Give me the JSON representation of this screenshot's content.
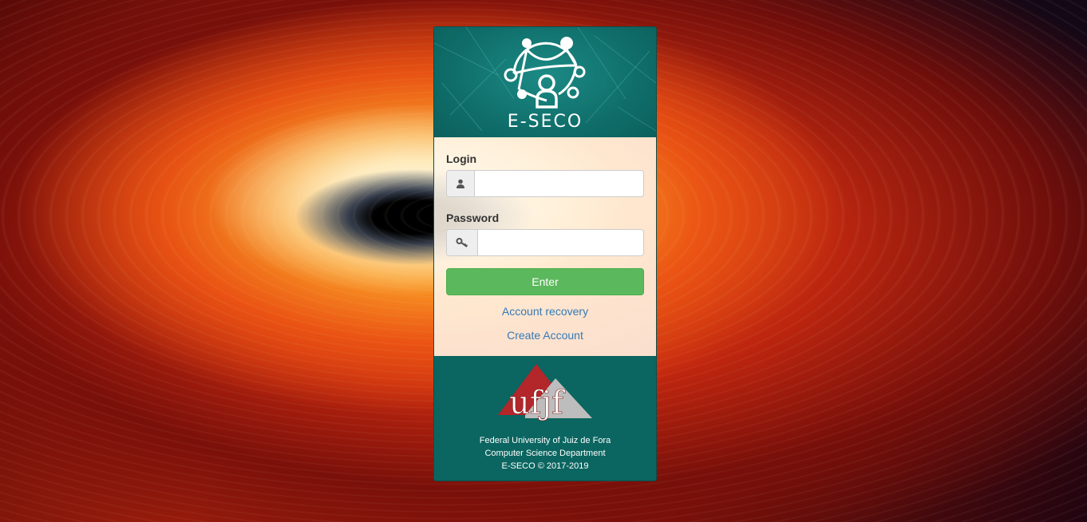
{
  "header": {
    "brand": "E-SECO"
  },
  "form": {
    "login_label": "Login",
    "login_value": "",
    "password_label": "Password",
    "password_value": "",
    "enter_label": "Enter",
    "account_recovery": "Account recovery",
    "create_account": "Create Account"
  },
  "footer": {
    "logo_text": "ufjf",
    "line1": "Federal University of Juiz de Fora",
    "line2": "Computer Science Department",
    "line3": "E-SECO © 2017-2019"
  },
  "colors": {
    "header_bg": "#0f6d69",
    "footer_bg": "#0b6560",
    "enter_button": "#5cb85c",
    "link": "#337ab7"
  },
  "icons": {
    "login": "user-icon",
    "password": "key-icon"
  }
}
